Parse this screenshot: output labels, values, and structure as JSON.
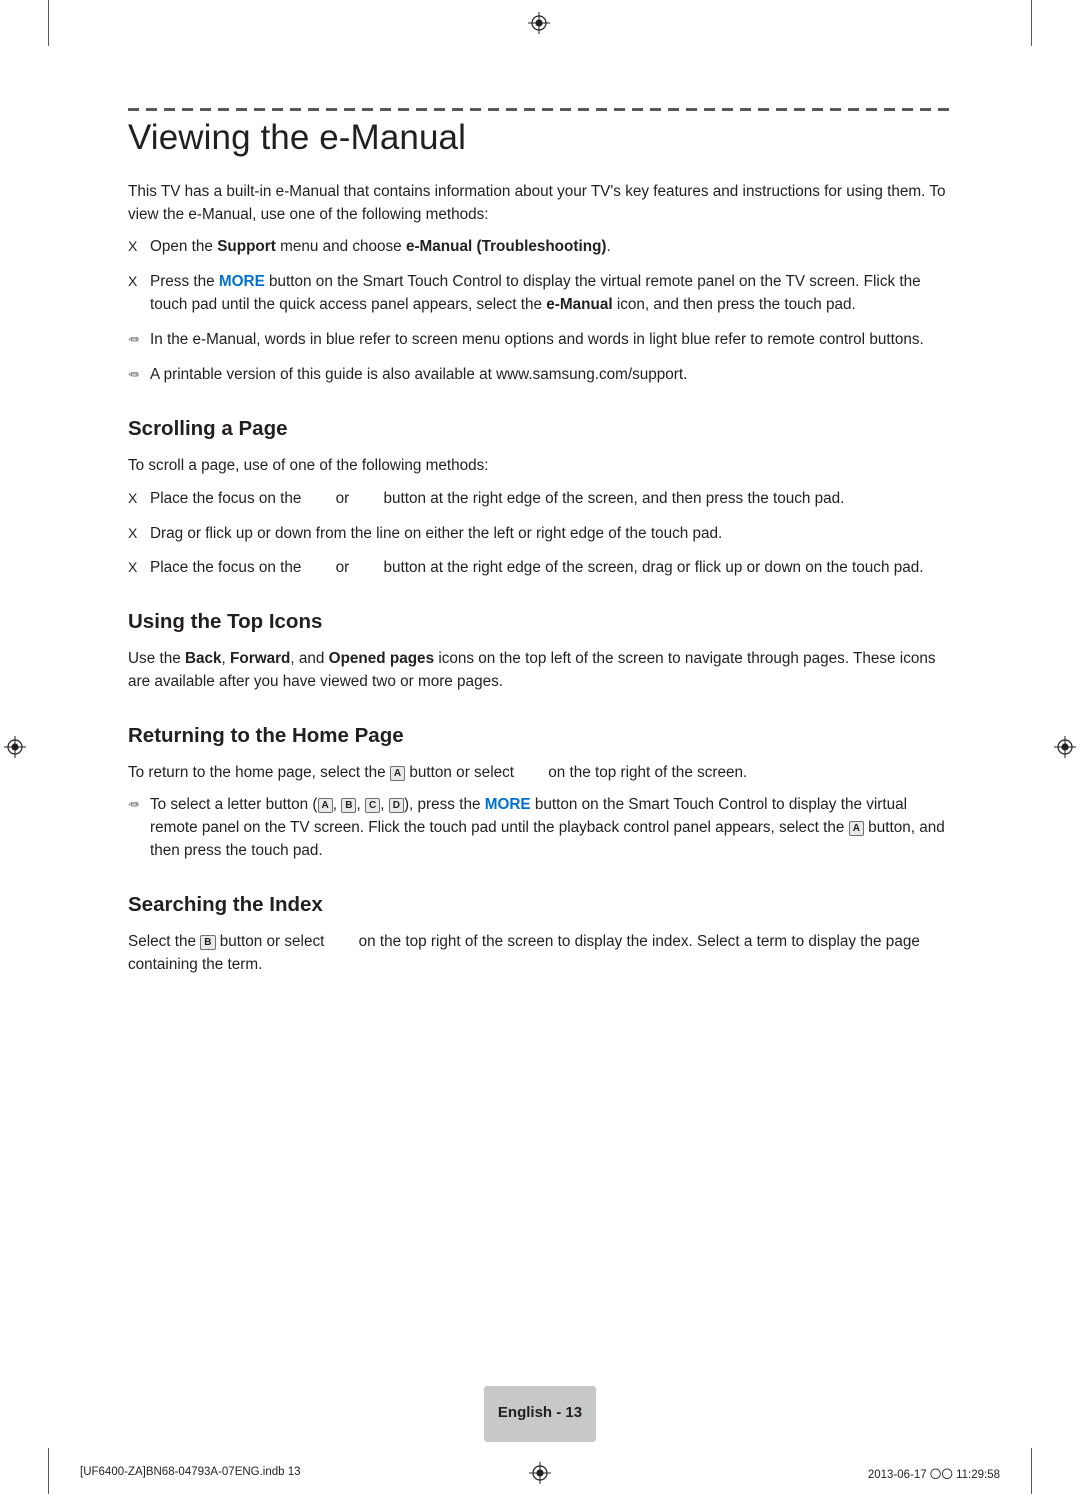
{
  "title": "Viewing the e-Manual",
  "intro": "This TV has a built-in e-Manual that contains information about your TV's key features and instructions for using them. To view the e-Manual, use one of the following methods:",
  "intro_bullets": [
    {
      "marker": "X",
      "parts": [
        {
          "t": "Open the ",
          "s": "plain"
        },
        {
          "t": "Support",
          "s": "bold"
        },
        {
          "t": " menu and choose ",
          "s": "plain"
        },
        {
          "t": "e-Manual (Troubleshooting)",
          "s": "bold"
        },
        {
          "t": ".",
          "s": "plain"
        }
      ]
    },
    {
      "marker": "X",
      "parts": [
        {
          "t": "Press the ",
          "s": "plain"
        },
        {
          "t": "MORE",
          "s": "more"
        },
        {
          "t": " button on the Smart Touch Control to display the virtual remote panel on the TV screen. Flick the touch pad until the quick access panel appears, select the ",
          "s": "plain"
        },
        {
          "t": "e-Manual",
          "s": "bold"
        },
        {
          "t": " icon, and then press the touch pad.",
          "s": "plain"
        }
      ]
    },
    {
      "marker": "note",
      "parts": [
        {
          "t": "In the e-Manual, words in blue refer to screen menu options and words in light blue refer to remote control buttons.",
          "s": "plain"
        }
      ]
    },
    {
      "marker": "note",
      "parts": [
        {
          "t": "A printable version of this guide is also available at www.samsung.com/support.",
          "s": "plain"
        }
      ]
    }
  ],
  "sections": [
    {
      "heading": "Scrolling a Page",
      "para": "To scroll a page, use of one of the following methods:",
      "bullets": [
        {
          "marker": "X",
          "parts": [
            {
              "t": "Place the focus on the ",
              "s": "plain"
            },
            {
              "t": "",
              "s": "ghost"
            },
            {
              "t": "or ",
              "s": "plain"
            },
            {
              "t": "",
              "s": "ghost"
            },
            {
              "t": "button at the right edge of the screen, and then press the touch pad.",
              "s": "plain"
            }
          ]
        },
        {
          "marker": "X",
          "parts": [
            {
              "t": "Drag or flick up or down from the line on either the left or right edge of the touch pad.",
              "s": "plain"
            }
          ]
        },
        {
          "marker": "X",
          "parts": [
            {
              "t": "Place the focus on the ",
              "s": "plain"
            },
            {
              "t": "",
              "s": "ghost"
            },
            {
              "t": "or ",
              "s": "plain"
            },
            {
              "t": "",
              "s": "ghost"
            },
            {
              "t": "button at the right edge of the screen, drag or flick up or down on the touch pad.",
              "s": "plain"
            }
          ]
        }
      ]
    },
    {
      "heading": "Using the Top Icons",
      "para_parts": [
        {
          "t": "Use the ",
          "s": "plain"
        },
        {
          "t": "Back",
          "s": "bold"
        },
        {
          "t": ", ",
          "s": "plain"
        },
        {
          "t": "Forward",
          "s": "bold"
        },
        {
          "t": ", and ",
          "s": "plain"
        },
        {
          "t": "Opened pages",
          "s": "bold"
        },
        {
          "t": " icons on the top left of the screen to navigate through pages. These icons are available after you have viewed two or more pages.",
          "s": "plain"
        }
      ],
      "bullets": []
    },
    {
      "heading": "Returning to the Home Page",
      "para_parts": [
        {
          "t": "To return to the home page, select the ",
          "s": "plain"
        },
        {
          "t": "A",
          "s": "key"
        },
        {
          "t": " button or select ",
          "s": "plain"
        },
        {
          "t": "",
          "s": "ghost"
        },
        {
          "t": "on the top right of the screen.",
          "s": "plain"
        }
      ],
      "bullets": [
        {
          "marker": "note",
          "parts": [
            {
              "t": "To select a letter button (",
              "s": "plain"
            },
            {
              "t": "A",
              "s": "key"
            },
            {
              "t": ", ",
              "s": "plain"
            },
            {
              "t": "B",
              "s": "key"
            },
            {
              "t": ", ",
              "s": "plain"
            },
            {
              "t": "C",
              "s": "key"
            },
            {
              "t": ", ",
              "s": "plain"
            },
            {
              "t": "D",
              "s": "key"
            },
            {
              "t": "), press the ",
              "s": "plain"
            },
            {
              "t": "MORE",
              "s": "more"
            },
            {
              "t": " button on the Smart Touch Control to display the virtual remote panel on the TV screen. Flick the touch pad until the playback control panel appears, select the ",
              "s": "plain"
            },
            {
              "t": "A",
              "s": "key"
            },
            {
              "t": " button, and then press the touch pad.",
              "s": "plain"
            }
          ]
        }
      ]
    },
    {
      "heading": "Searching the Index",
      "para_parts": [
        {
          "t": "Select the ",
          "s": "plain"
        },
        {
          "t": "B",
          "s": "key"
        },
        {
          "t": " button or select ",
          "s": "plain"
        },
        {
          "t": "",
          "s": "ghost"
        },
        {
          "t": "on the top right of the screen to display the index. Select a term to display the page containing the term.",
          "s": "plain"
        }
      ],
      "bullets": []
    }
  ],
  "footer": {
    "page_label": "English - 13",
    "left": "[UF6400-ZA]BN68-04793A-07ENG.indb   13",
    "right": "2013-06-17   〇〇 11:29:58"
  }
}
